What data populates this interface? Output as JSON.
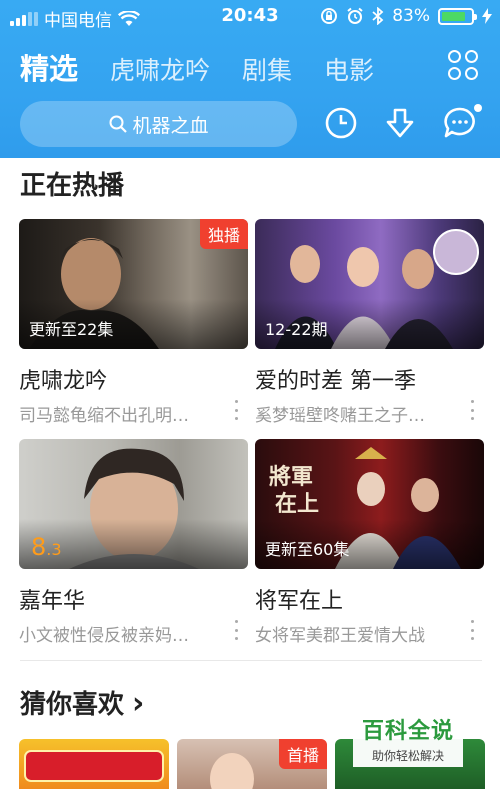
{
  "status_bar": {
    "carrier": "中国电信",
    "time": "20:43",
    "battery": "83%",
    "battery_level": 0.83
  },
  "tabs": [
    {
      "label": "精选",
      "active": true
    },
    {
      "label": "虎啸龙吟",
      "active": false
    },
    {
      "label": "剧集",
      "active": false
    },
    {
      "label": "电影",
      "active": false
    }
  ],
  "icons": {
    "menu": "grid-icon",
    "history": "clock-icon",
    "download": "download-icon",
    "message": "message-icon"
  },
  "search": {
    "placeholder": "机器之血"
  },
  "sections": {
    "now_playing": "正在热播",
    "guess_you_like": "猜你喜欢",
    "guess_chevron": "›"
  },
  "cards": [
    {
      "title": "虎啸龙吟",
      "subtitle": "司马懿龟缩不出孔明…",
      "badge": "独播",
      "episode": "更新至22集"
    },
    {
      "title": "爱的时差 第一季",
      "subtitle": "奚梦瑶壁咚赌王之子…",
      "episode": "12-22期"
    },
    {
      "title": "嘉年华",
      "subtitle": "小文被性侵反被亲妈…",
      "score_int": "8",
      "score_dec": ".3"
    },
    {
      "title": "将军在上",
      "subtitle": "女将军美郡王爱情大战",
      "episode": "更新至60集"
    }
  ],
  "recommend": {
    "badge": "首播"
  },
  "watermark": {
    "title": "百科全说",
    "subtitle": "助你轻松解决"
  },
  "colors": {
    "header": "#38aaf3",
    "badge": "#f0402f",
    "score": "#ff9c1a",
    "battery": "#4cd964"
  }
}
